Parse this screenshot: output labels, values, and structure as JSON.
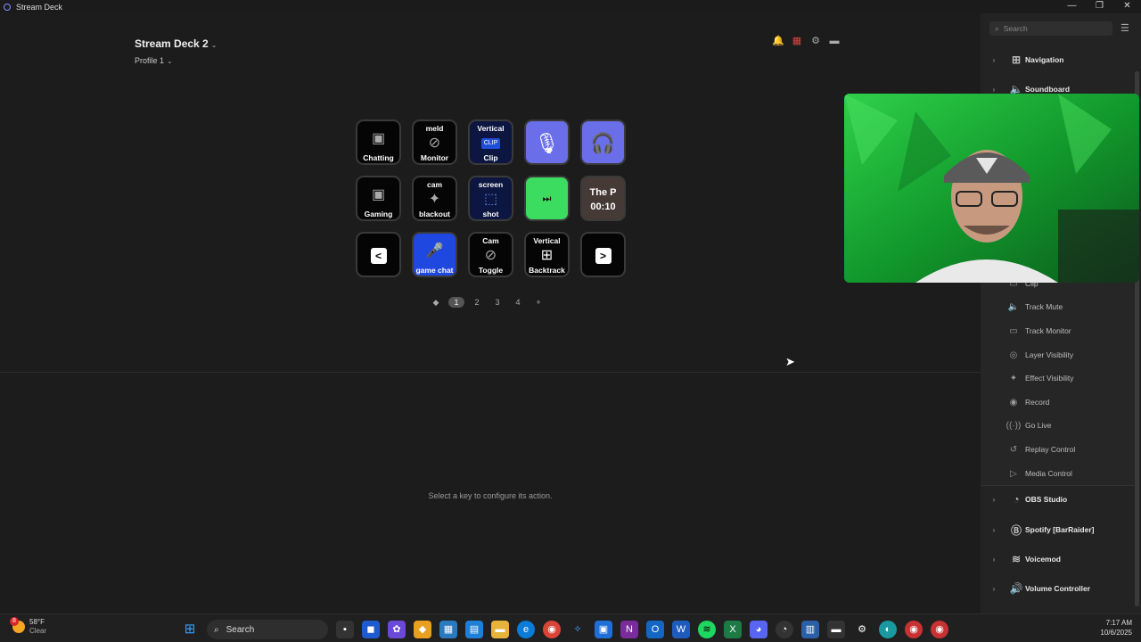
{
  "window": {
    "title": "Stream Deck",
    "controls": [
      "—",
      "❐",
      "✕"
    ]
  },
  "header": {
    "device": "Stream Deck 2",
    "profile": "Profile 1"
  },
  "keys": [
    {
      "top": "",
      "icon": "▣",
      "bottom": "Chatting"
    },
    {
      "top": "meld",
      "icon": "⊘",
      "bottom": "Monitor"
    },
    {
      "top": "Vertical",
      "icon": "CLIP",
      "bottom": "Clip"
    },
    {
      "top": "",
      "icon": "🎙",
      "bottom": ""
    },
    {
      "top": "",
      "icon": "🎧",
      "bottom": ""
    },
    {
      "top": "",
      "icon": "▣",
      "bottom": "Gaming"
    },
    {
      "top": "cam",
      "icon": "✦",
      "bottom": "blackout"
    },
    {
      "top": "screen",
      "icon": "⬚",
      "bottom": "shot"
    },
    {
      "top": "",
      "icon": "⏭",
      "bottom": ""
    },
    {
      "top": "The P",
      "icon": "",
      "bottom": "00:10"
    },
    {
      "top": "",
      "icon": "<",
      "bottom": ""
    },
    {
      "top": "",
      "icon": "🎤",
      "bottom": "game chat"
    },
    {
      "top": "Cam",
      "icon": "⊘",
      "bottom": "Toggle"
    },
    {
      "top": "Vertical",
      "icon": "⊞",
      "bottom": "Backtrack"
    },
    {
      "top": "",
      "icon": ">",
      "bottom": ""
    }
  ],
  "pager": {
    "pages": [
      "1",
      "2",
      "3",
      "4"
    ],
    "add": "+",
    "active_page": "1"
  },
  "hint": "Select a key to configure its action.",
  "sidebar": {
    "search_placeholder": "Search",
    "categories_top": [
      {
        "label": "Navigation",
        "icon": "navigation-icon"
      },
      {
        "label": "Soundboard",
        "icon": "speaker-icon"
      }
    ],
    "sub_items": [
      {
        "label": "Clip",
        "icon": "clip-icon"
      },
      {
        "label": "Track Mute",
        "icon": "speaker-icon"
      },
      {
        "label": "Track Monitor",
        "icon": "monitor-icon"
      },
      {
        "label": "Layer Visibility",
        "icon": "eye-icon"
      },
      {
        "label": "Effect Visibility",
        "icon": "sparkle-icon"
      },
      {
        "label": "Record",
        "icon": "record-icon"
      },
      {
        "label": "Go Live",
        "icon": "broadcast-icon"
      },
      {
        "label": "Replay Control",
        "icon": "replay-icon"
      },
      {
        "label": "Media Control",
        "icon": "media-icon"
      }
    ],
    "categories_bottom": [
      {
        "label": "OBS Studio",
        "icon": "obs-icon"
      },
      {
        "label": "Spotify [BarRaider]",
        "icon": "barraider-icon"
      },
      {
        "label": "Voicemod",
        "icon": "voicemod-icon"
      },
      {
        "label": "Volume Controller",
        "icon": "volume-controller-icon"
      }
    ]
  },
  "taskbar": {
    "weather_temp": "58°F",
    "weather_desc": "Clear",
    "weather_badge": "8",
    "search_label": "Search",
    "time": "7:17 AM",
    "date": "10/6/2025"
  }
}
